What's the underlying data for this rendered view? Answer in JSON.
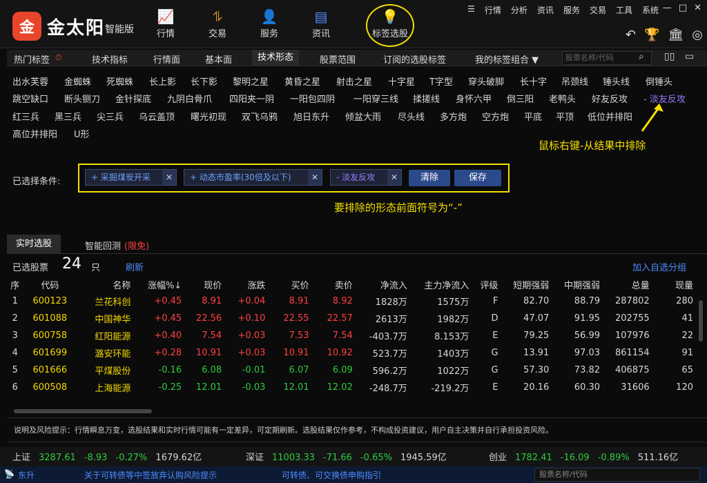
{
  "app": {
    "brand": "金太阳",
    "edition": "智能版",
    "logo_char": "金"
  },
  "nav": [
    {
      "label": "行情",
      "icon": "chart-line-icon"
    },
    {
      "label": "交易",
      "icon": "trade-icon"
    },
    {
      "label": "服务",
      "icon": "user-icon"
    },
    {
      "label": "资讯",
      "icon": "news-icon"
    },
    {
      "label": "标签选股",
      "icon": "lightbulb-icon"
    }
  ],
  "top_menu": [
    "行情",
    "分析",
    "资讯",
    "服务",
    "交易",
    "工具",
    "系统"
  ],
  "tabs": [
    "热门标签",
    "技术指标",
    "行情面",
    "基本面",
    "技术形态",
    "股票范围",
    "订阅的选股标签",
    "我的标签组合 ▼"
  ],
  "search_placeholder": "股票名称/代码",
  "patterns": [
    [
      "出水芙蓉",
      "金蜘蛛",
      "死蜘蛛",
      "长上影",
      "长下影",
      "黎明之星",
      "黄昏之星",
      "射击之星",
      "十字星",
      "T字型",
      "穿头破脚",
      "长十字",
      "吊颈线",
      "锤头线",
      "倒锤头"
    ],
    [
      "跳空缺口",
      "断头铡刀",
      "金针探底",
      "九阴白骨爪",
      "四阳夹一阴",
      "一阳包四阴",
      "一阳穿三线",
      "揉搓线",
      "身怀六甲",
      "倒三阳",
      "老鸭头",
      "好友反攻",
      "- 淡友反攻"
    ],
    [
      "红三兵",
      "黑三兵",
      "尖三兵",
      "乌云盖顶",
      "曙光初现",
      "双飞乌鸦",
      "旭日东升",
      "倾盆大雨",
      "尽头线",
      "多方炮",
      "空方炮",
      "平底",
      "平顶",
      "低位并排阳"
    ],
    [
      "高位并排阳",
      "U形"
    ]
  ],
  "annotations": {
    "right_click": "鼠标右键-从结果中排除",
    "minus_note": "要排除的形态前面符号为“-”"
  },
  "conditions": {
    "label": "已选择条件:",
    "chips": [
      "+ 采掘煤炭开采",
      "+ 动态市盈率(30倍及以下)",
      "- 淡友反攻"
    ],
    "clear": "清除",
    "save": "保存"
  },
  "subtabs": {
    "realtime": "实时选股",
    "backtest": "智能回测",
    "limited": "(限免)"
  },
  "selection": {
    "label": "已选股票",
    "count": "24",
    "unit": "只",
    "refresh": "刷新",
    "add_group": "加入自选分组"
  },
  "table": {
    "headers": [
      "序",
      "代码",
      "名称",
      "涨幅%↓",
      "现价",
      "涨跌",
      "买价",
      "卖价",
      "净流入",
      "主力净流入",
      "评级",
      "短期强弱",
      "中期强弱",
      "总量",
      "现量"
    ],
    "rows": [
      [
        "1",
        "600123",
        "兰花科创",
        "+0.45",
        "8.91",
        "+0.04",
        "8.91",
        "8.92",
        "1828万",
        "1575万",
        "F",
        "82.70",
        "88.79",
        "287802",
        "280"
      ],
      [
        "2",
        "601088",
        "中国神华",
        "+0.45",
        "22.56",
        "+0.10",
        "22.55",
        "22.57",
        "2613万",
        "1982万",
        "D",
        "47.07",
        "91.95",
        "202755",
        "41"
      ],
      [
        "3",
        "600758",
        "红阳能源",
        "+0.40",
        "7.54",
        "+0.03",
        "7.53",
        "7.54",
        "-403.7万",
        "8.153万",
        "E",
        "79.25",
        "56.99",
        "107976",
        "22"
      ],
      [
        "4",
        "601699",
        "潞安环能",
        "+0.28",
        "10.91",
        "+0.03",
        "10.91",
        "10.92",
        "523.7万",
        "1403万",
        "G",
        "13.91",
        "97.03",
        "861154",
        "91"
      ],
      [
        "5",
        "601666",
        "平煤股份",
        "-0.16",
        "6.08",
        "-0.01",
        "6.07",
        "6.09",
        "596.2万",
        "1022万",
        "G",
        "57.30",
        "73.82",
        "406875",
        "65"
      ],
      [
        "6",
        "600508",
        "上海能源",
        "-0.25",
        "12.01",
        "-0.03",
        "12.01",
        "12.02",
        "-248.7万",
        "-219.2万",
        "E",
        "20.16",
        "60.30",
        "31606",
        "120"
      ]
    ]
  },
  "risk": "说明及风险提示：行情瞬息万变，选股结果和实时行情可能有一定差异，可定期刷新。选股结果仅作参考，不构成投资建议，用户自主决策并自行承担投资风险。",
  "ticker": [
    {
      "name": "上证",
      "price": "3287.61",
      "chg": "-8.93",
      "pct": "-0.27%",
      "amt": "1679.62亿"
    },
    {
      "name": "深证",
      "price": "11003.33",
      "chg": "-71.66",
      "pct": "-0.65%",
      "amt": "1945.59亿"
    },
    {
      "name": "创业",
      "price": "1782.41",
      "chg": "-16.09",
      "pct": "-0.89%",
      "amt": "511.16亿"
    }
  ],
  "status": {
    "left": "东升",
    "msg1": "关于可转债等中签放弃认购风险提示",
    "msg2": "可转债、可交换债申购指引",
    "search": "股票名称/代码"
  }
}
